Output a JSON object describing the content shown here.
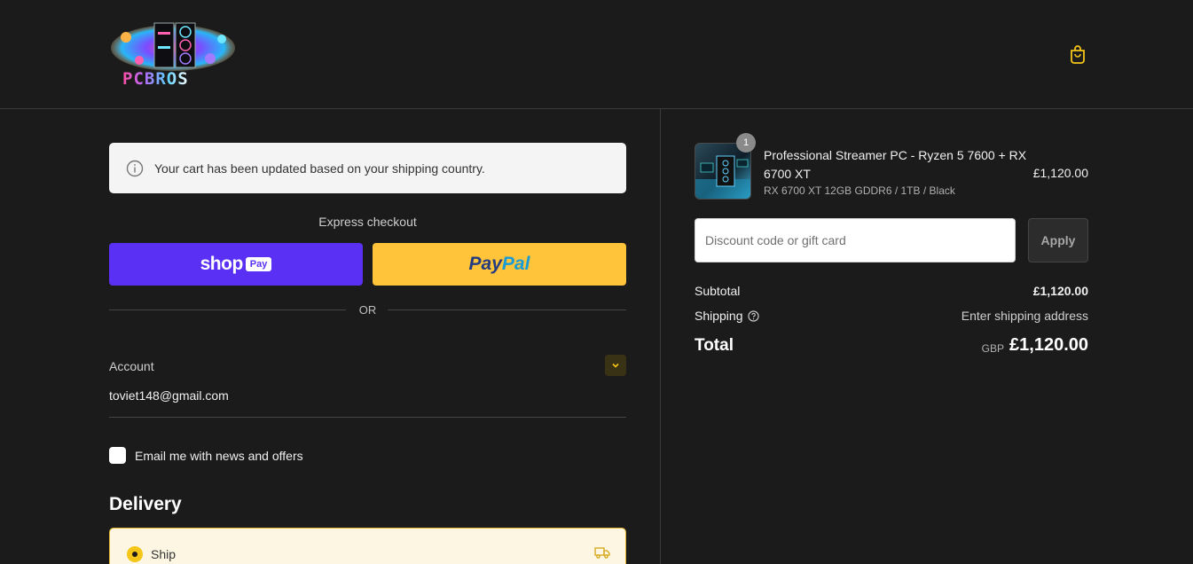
{
  "header": {
    "logo_text": "PCBROS",
    "cart_icon": "shopping-bag-icon"
  },
  "notice": {
    "icon": "info-icon",
    "text": "Your cart has been updated based on your shipping country."
  },
  "express": {
    "label": "Express checkout",
    "shop_pay": {
      "word": "shop",
      "badge": "Pay"
    },
    "paypal": {
      "part1": "Pay",
      "part2": "Pal"
    },
    "separator": "OR"
  },
  "account": {
    "label": "Account",
    "email": "toviet148@gmail.com",
    "toggle_icon": "chevron-down-icon"
  },
  "newsletter": {
    "label": "Email me with news and offers",
    "checked": false
  },
  "delivery": {
    "title": "Delivery",
    "option_label": "Ship",
    "option_icon": "truck-icon"
  },
  "order": {
    "product": {
      "quantity": "1",
      "name": "Professional Streamer PC - Ryzen 5 7600 + RX 6700 XT",
      "variant": "RX 6700 XT 12GB GDDR6 / 1TB / Black",
      "price": "£1,120.00"
    },
    "discount": {
      "placeholder": "Discount code or gift card",
      "apply_label": "Apply"
    },
    "subtotal": {
      "label": "Subtotal",
      "value": "£1,120.00"
    },
    "shipping": {
      "label": "Shipping",
      "value": "Enter shipping address"
    },
    "total": {
      "label": "Total",
      "currency": "GBP",
      "value": "£1,120.00"
    }
  },
  "colors": {
    "background": "#1b1b1b",
    "accent": "#f5c518",
    "shop_pay": "#5a31f4",
    "paypal": "#ffc439"
  }
}
